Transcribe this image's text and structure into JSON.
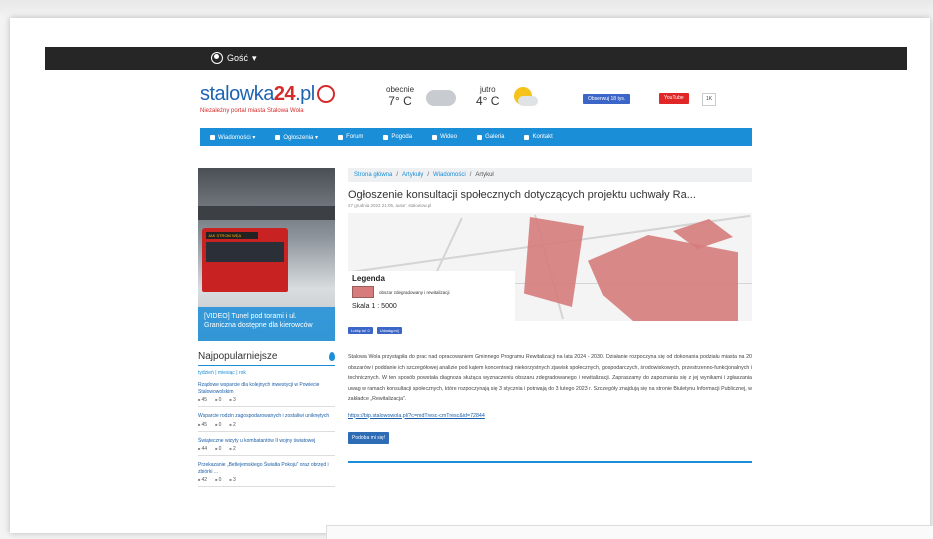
{
  "topbar": {
    "user_label": "Gość",
    "caret": "▾"
  },
  "header": {
    "logo_text": "stalowka",
    "logo_num": "24",
    "logo_tld": ".pl",
    "tagline": "Niezależny portal miasta Stalowa Wola",
    "weather_now_label": "obecnie",
    "weather_now_temp": "7° C",
    "weather_tomorrow_label": "jutro",
    "weather_tomorrow_temp": "4° C",
    "fb_button": "Obserwuj 18 tys.",
    "yt_button": "YouTube",
    "yt_count": "1K"
  },
  "nav": {
    "items": [
      {
        "label": "Wiadomości ▾"
      },
      {
        "label": "Ogłoszenia ▾"
      },
      {
        "label": "Forum"
      },
      {
        "label": "Pogoda"
      },
      {
        "label": "Wideo"
      },
      {
        "label": "Galeria"
      },
      {
        "label": "Kontakt"
      }
    ]
  },
  "sidebar": {
    "promo_sign": "JAK STROM WĘA",
    "promo_caption": "[VIDEO] Tunel pod torami i ul. Graniczna dostępne dla kierowców",
    "popular_title": "Najpopularniejsze",
    "filters": "tydzień  |  miesiąc  |  rok",
    "items": [
      {
        "text": "Rządowe wsparcie dla kolejnych inwestycji w Powiecie Stalowowolskim",
        "views": "45",
        "comments": "0",
        "likes": "3"
      },
      {
        "text": "Wsparcie rodzin zagospodarowanych i zostaliwi uniknętych",
        "views": "45",
        "comments": "0",
        "likes": "2"
      },
      {
        "text": "Świąteczne wizyty u kombatantów II wojny światowej",
        "views": "44",
        "comments": "0",
        "likes": "2"
      },
      {
        "text": "Przekazanie „Betlejemskiego Światła Pokoju” oraz obrzęd i zbiórki ...",
        "views": "42",
        "comments": "0",
        "likes": "3"
      }
    ]
  },
  "main": {
    "breadcrumb": [
      "Strona główna",
      "Artykuły",
      "Wiadomości",
      "Artykuł"
    ],
    "title": "Ogłoszenie konsultacji społecznych dotyczących projektu uchwały Ra...",
    "meta": "27 grudnia 2022 21:05, autor: stalowow.pl",
    "legend_title": "Legenda",
    "legend_item": "obszar zdegradowany i rewitalizacji",
    "legend_scale": "Skala 1 : 5000",
    "fb_like": "Lubię to! 0",
    "fb_share": "Udostępnij",
    "body": "Stalowa Wola przystąpiła do prac nad opracowaniem Gminnego Programu Rewitalizacji na lata 2024 - 2030. Działanie rozpoczyna się od dokonania podziału miasta na 20 obszarów i poddanie ich szczegółowej analizie pod kątem koncentracji niekorzystnych zjawisk społecznych, gospodarczych, środowiskowych, przestrzenno-funkcjonalnych i technicznych. W ten sposób powstała diagnoza służąca wyznaczeniu obszaru zdegradowanego i rewitalizacji. Zapraszamy do zapoznania się z jej wynikami i zgłaszania uwag w ramach konsultacji społecznych, które rozpoczynają się 3 stycznia i potrwają do 3 lutego 2023 r. Szczegóły znajdują się na stronie Biuletynu Informacji Publicznej, w zakładce „Rewitalizacja”.",
    "url": "https://bip.stalowowola.pl/?c=mdTresc-cmTresc&id=72844",
    "share_button": "Podoba mi się!"
  }
}
